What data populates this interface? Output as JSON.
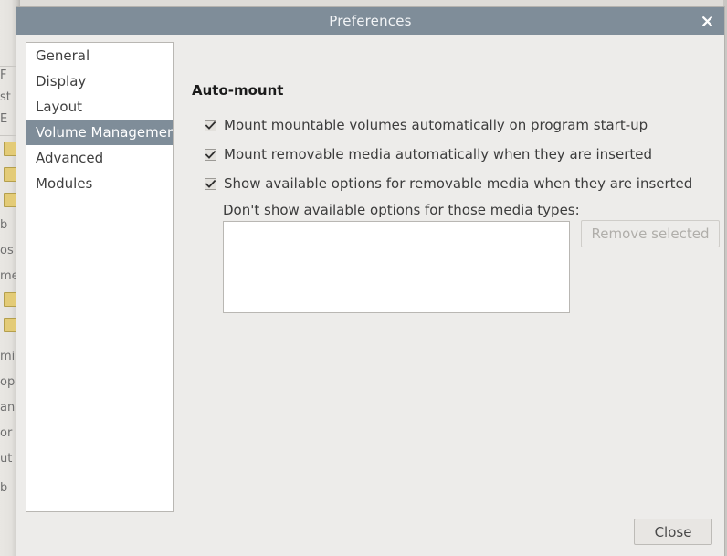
{
  "window": {
    "title": "Preferences",
    "close_icon": "close-x-icon",
    "close_icon_glyph": "✖",
    "titlebar_color": "#7f8d99"
  },
  "sidebar": {
    "items": [
      {
        "label": "General",
        "selected": false
      },
      {
        "label": "Display",
        "selected": false
      },
      {
        "label": "Layout",
        "selected": false
      },
      {
        "label": "Volume Management",
        "selected": true
      },
      {
        "label": "Advanced",
        "selected": false
      },
      {
        "label": "Modules",
        "selected": false
      }
    ]
  },
  "main": {
    "section_title": "Auto-mount",
    "checkboxes": [
      {
        "label": "Mount mountable volumes automatically on program start-up",
        "checked": true
      },
      {
        "label": "Mount removable media automatically when they are inserted",
        "checked": true
      },
      {
        "label": "Show available options for removable media when they are inserted",
        "checked": true
      }
    ],
    "media_types_label": "Don't show available options for those media types:",
    "media_types_items": [],
    "remove_button": {
      "label": "Remove selected",
      "enabled": false
    }
  },
  "footer": {
    "close_button": {
      "label": "Close",
      "enabled": true
    }
  },
  "backdrop": {
    "text_fragments": [
      "F",
      "st",
      "E",
      "b",
      "os",
      "me",
      "mi",
      "op",
      "an",
      "or",
      "ut",
      "b"
    ]
  }
}
